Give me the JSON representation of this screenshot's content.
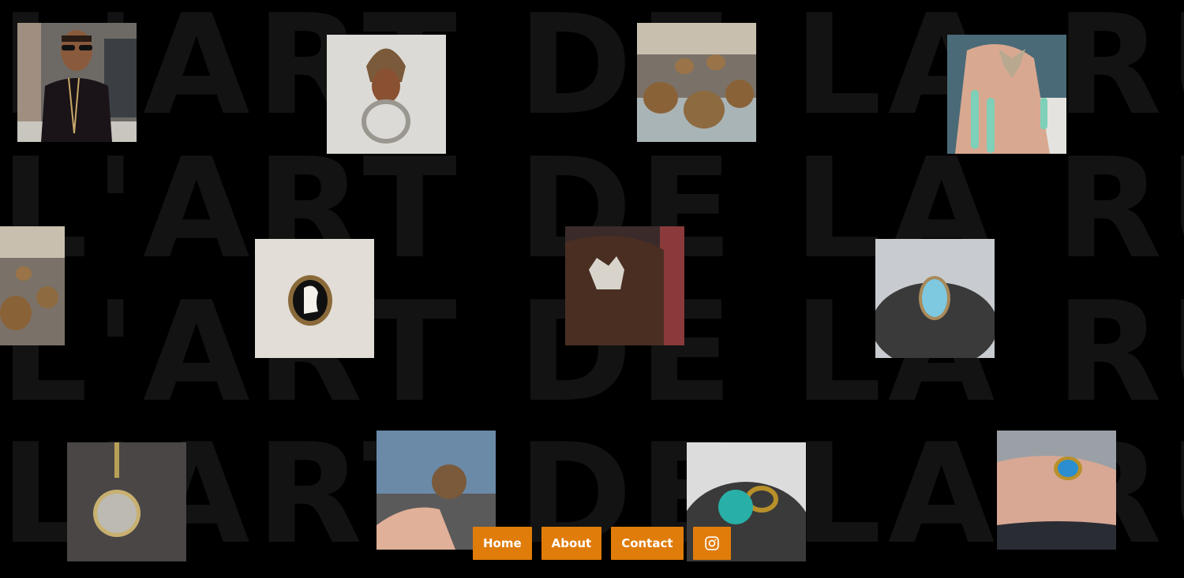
{
  "background": {
    "text_rows": [
      "L'ART DE LA RUE",
      "L'ART DE LA RUE",
      "L'ART DE LA RUE",
      "L'ART DE LA RUE"
    ]
  },
  "gallery": [
    {
      "name": "photo-man-with-necklace"
    },
    {
      "name": "photo-bronze-head-ring"
    },
    {
      "name": "photo-signet-rings-display"
    },
    {
      "name": "photo-bull-skull-ring-hand"
    },
    {
      "name": "photo-rings-display-cropped"
    },
    {
      "name": "photo-cameo-ring"
    },
    {
      "name": "photo-chief-ring-hand"
    },
    {
      "name": "photo-turquoise-oval-ring"
    },
    {
      "name": "photo-coin-pendant"
    },
    {
      "name": "photo-coin-ring-held"
    },
    {
      "name": "photo-turquoise-crown-ring"
    },
    {
      "name": "photo-turquoise-ring-hand"
    }
  ],
  "nav": {
    "home_label": "Home",
    "about_label": "About",
    "contact_label": "Contact",
    "instagram_icon": "instagram-icon"
  },
  "colors": {
    "background": "#000000",
    "watermark_text": "#131313",
    "accent": "#e07c0a"
  }
}
